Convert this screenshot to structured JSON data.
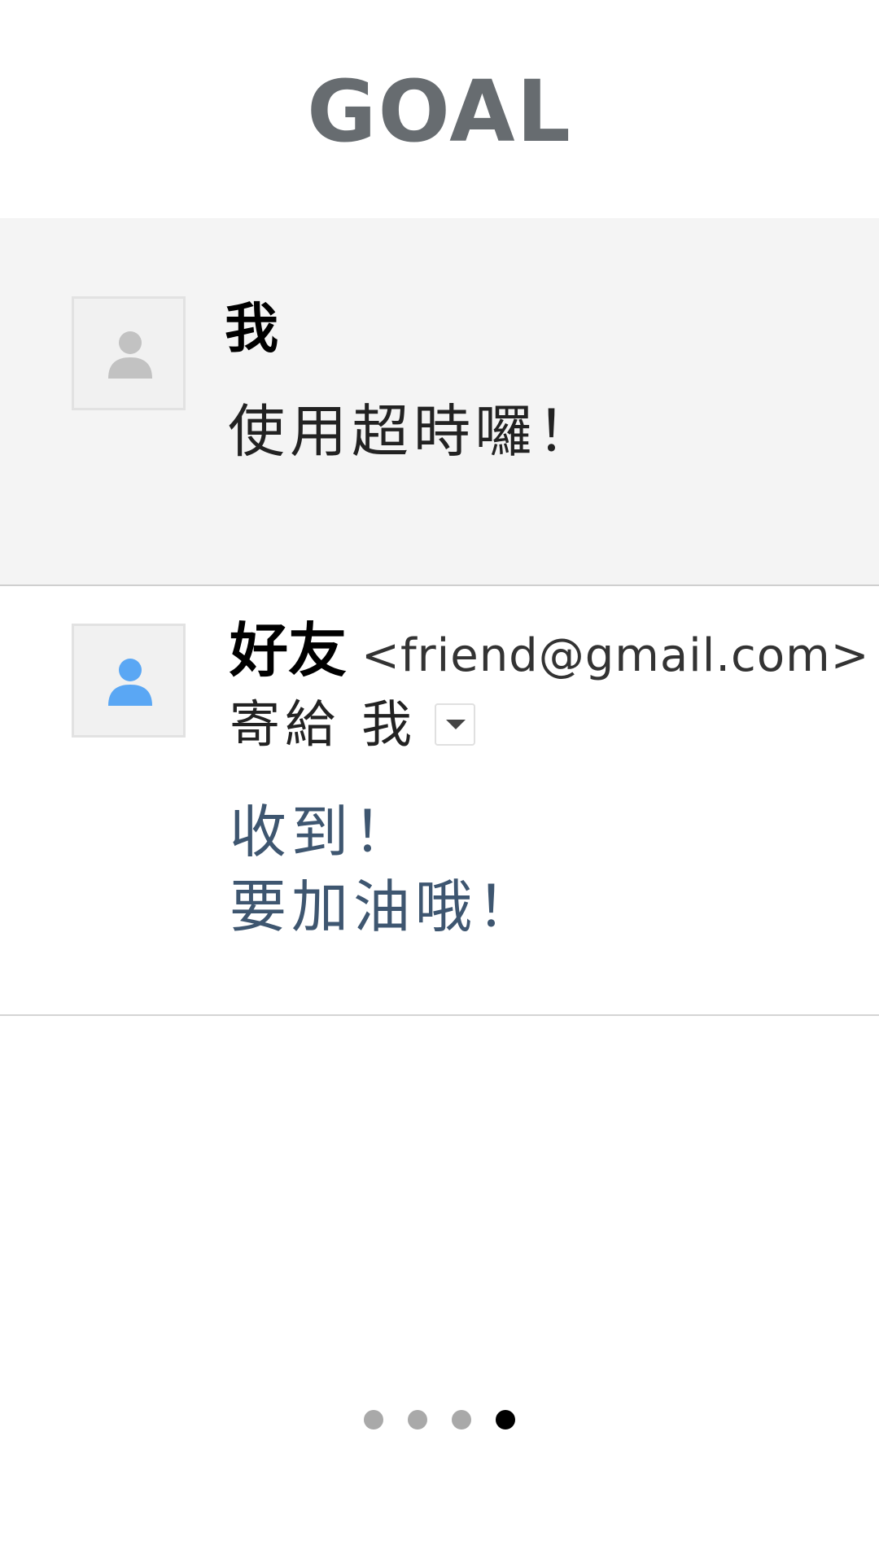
{
  "title": "GOAL",
  "self_message": {
    "sender": "我",
    "body": "使用超時囉！",
    "avatar_icon": "person-icon",
    "avatar_color": "#c2c2c2"
  },
  "friend_message": {
    "sender": "好友",
    "email": "<friend@gmail.com>",
    "recipient_label": "寄給",
    "recipient": "我",
    "avatar_icon": "person-icon",
    "avatar_color": "#5aa7f4",
    "body_lines": [
      "收到！",
      "要加油哦！"
    ],
    "body_color": "#3e5670"
  },
  "pager": {
    "total_pages": 4,
    "current_page": 4
  }
}
